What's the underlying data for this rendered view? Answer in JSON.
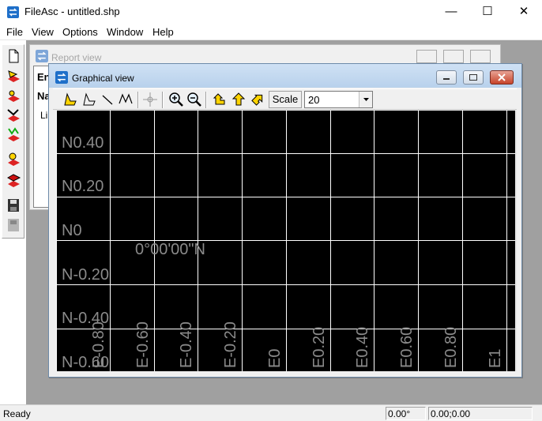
{
  "app": {
    "title": "FileAsc - untitled.shp",
    "window_buttons": [
      "—",
      "☐",
      "✕"
    ]
  },
  "menu": [
    "File",
    "View",
    "Options",
    "Window",
    "Help"
  ],
  "toolbar_icons": [
    "new-file-icon",
    "open-layer-icon",
    "open-points-icon",
    "open-lines-icon",
    "open-polygons-icon",
    "import-icon",
    "export-icon",
    "save-icon",
    "print-icon"
  ],
  "report_view": {
    "title": "Report view",
    "cells": [
      "En",
      "Na",
      "Li"
    ]
  },
  "graphical_view": {
    "title": "Graphical view",
    "tool_icons": [
      "polygon-tool-icon",
      "polyline-tool-icon",
      "line-tool-icon",
      "multiline-tool-icon",
      "crosshair-icon",
      "zoom-in-icon",
      "zoom-out-icon",
      "pan-left-icon",
      "pan-up-icon",
      "pan-right-icon"
    ],
    "scale_label": "Scale",
    "scale_value": "20"
  },
  "map": {
    "y_labels": [
      "N0.40",
      "N0.20",
      "N0",
      "N-0.20",
      "N-0.40",
      "N-0.60"
    ],
    "x_labels": [
      "E-0.80",
      "E-0.60",
      "E-0.40",
      "E-0.20",
      "E0",
      "E0.20",
      "E0.40",
      "E0.60",
      "E0.80",
      "E1"
    ],
    "center_label": "0°00'00\"N",
    "colors": {
      "background": "#000000",
      "grid": "#ffffff",
      "labels": "#8a8a8a"
    }
  },
  "status": {
    "text": "Ready",
    "angle": "0.00°",
    "coords": "0.00;0.00"
  }
}
